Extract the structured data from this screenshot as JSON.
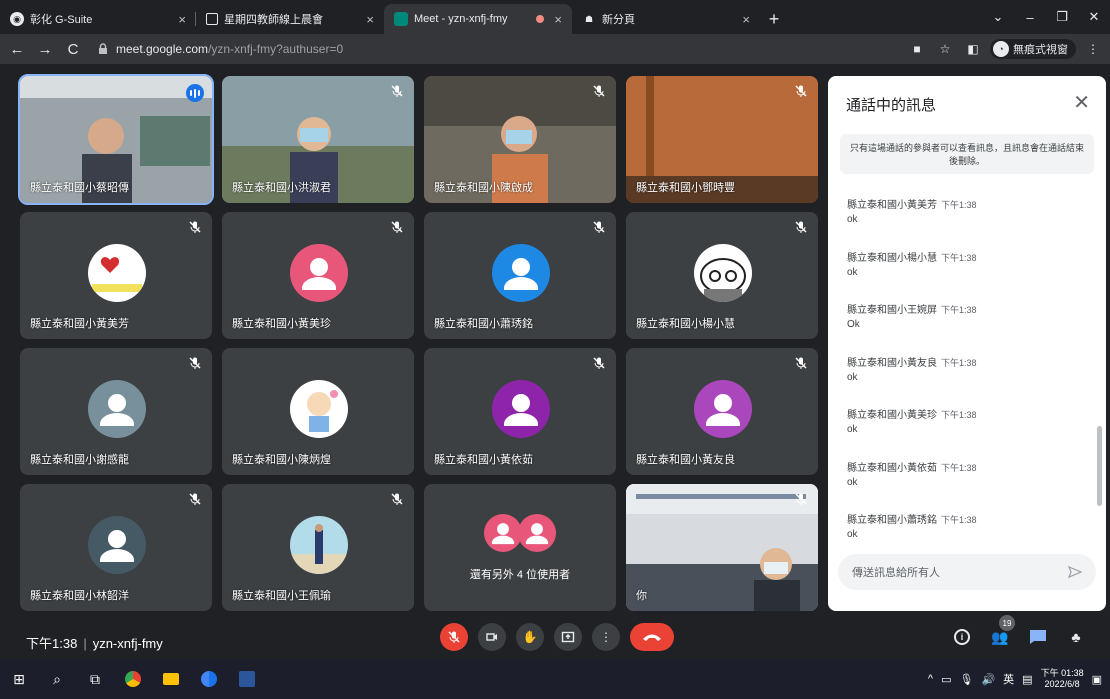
{
  "browser": {
    "tabs": [
      {
        "title": "彰化 G-Suite",
        "close": "×"
      },
      {
        "title": "星期四教師線上晨會",
        "close": "×"
      },
      {
        "title": "Meet - yzn-xnfj-fmy",
        "close": "×"
      },
      {
        "title": "新分頁",
        "close": "×"
      }
    ],
    "new_tab": "+",
    "url_host": "meet.google.com",
    "url_path": "/yzn-xnfj-fmy?authuser=0",
    "incognito_label": "無痕式視窗"
  },
  "tiles": [
    {
      "name": "縣立泰和國小蔡昭傳",
      "kind": "video",
      "scene": "office",
      "speaking": true
    },
    {
      "name": "縣立泰和國小洪淑君",
      "kind": "video",
      "scene": "classroom",
      "muted": true
    },
    {
      "name": "縣立泰和國小陳啟成",
      "kind": "video",
      "scene": "bookshelf",
      "muted": true
    },
    {
      "name": "縣立泰和國小鄧時豐",
      "kind": "video",
      "scene": "door",
      "muted": true
    },
    {
      "name": "縣立泰和國小黃美芳",
      "kind": "avatar",
      "avatar": "heart",
      "muted": true
    },
    {
      "name": "縣立泰和國小黃美珍",
      "kind": "avatar",
      "color": "#e8577a",
      "muted": true
    },
    {
      "name": "縣立泰和國小蕭琇銘",
      "kind": "avatar",
      "color": "#1e88e5",
      "muted": true
    },
    {
      "name": "縣立泰和國小楊小慧",
      "kind": "avatar",
      "avatar": "kitty",
      "muted": true
    },
    {
      "name": "縣立泰和國小謝感龍",
      "kind": "avatar",
      "color": "#78909c",
      "muted": true
    },
    {
      "name": "縣立泰和國小陳炳煌",
      "kind": "avatar",
      "avatar": "baby",
      "muted": false
    },
    {
      "name": "縣立泰和國小黃依茹",
      "kind": "avatar",
      "color": "#8e24aa",
      "muted": true
    },
    {
      "name": "縣立泰和國小黃友良",
      "kind": "avatar",
      "color": "#ab47bc",
      "muted": true
    },
    {
      "name": "縣立泰和國小林韶洋",
      "kind": "avatar",
      "color": "#455a64",
      "muted": true
    },
    {
      "name": "縣立泰和國小王佩瑜",
      "kind": "avatar",
      "avatar": "photo",
      "muted": true
    },
    {
      "name": "還有另外 4 位使用者",
      "kind": "more"
    },
    {
      "name": "你",
      "kind": "video",
      "scene": "self",
      "muted": true
    }
  ],
  "chat": {
    "title": "通話中的訊息",
    "notice": "只有這場通話的參與者可以查看訊息，且訊息會在通話結束後刪除。",
    "messages": [
      {
        "sender": "縣立泰和國小黃美芳",
        "time": "下午1:38",
        "text": "ok"
      },
      {
        "sender": "縣立泰和國小楊小慧",
        "time": "下午1:38",
        "text": "ok"
      },
      {
        "sender": "縣立泰和國小王婉屏",
        "time": "下午1:38",
        "text": "Ok"
      },
      {
        "sender": "縣立泰和國小黃友良",
        "time": "下午1:38",
        "text": "ok"
      },
      {
        "sender": "縣立泰和國小黃美珍",
        "time": "下午1:38",
        "text": "ok"
      },
      {
        "sender": "縣立泰和國小黃依茹",
        "time": "下午1:38",
        "text": "ok"
      },
      {
        "sender": "縣立泰和國小蕭琇銘",
        "time": "下午1:38",
        "text": "ok"
      }
    ],
    "input_placeholder": "傳送訊息給所有人"
  },
  "meeting": {
    "time": "下午1:38",
    "code": "yzn-xnfj-fmy",
    "participants_count": "19"
  },
  "taskbar": {
    "ime": "英",
    "clock_time": "下午 01:38",
    "clock_date": "2022/6/8"
  }
}
